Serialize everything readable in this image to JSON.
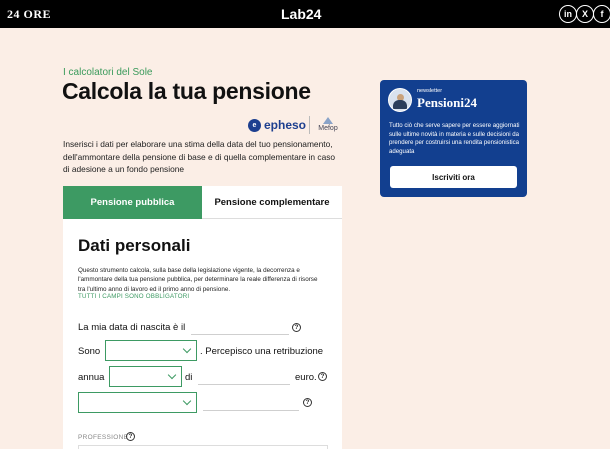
{
  "topbar": {
    "brand_left": "24 ORE",
    "brand_center": "Lab24",
    "social": [
      {
        "icon": "linkedin-icon",
        "glyph": "in"
      },
      {
        "icon": "x-icon",
        "glyph": "X"
      },
      {
        "icon": "facebook-icon",
        "glyph": "f"
      }
    ]
  },
  "hero": {
    "eyebrow": "I calcolatori del Sole",
    "title": "Calcola la tua pensione",
    "sponsor_epheso": "epheso",
    "sponsor_epheso_mark": "e",
    "sponsor_mefop": "Mefop",
    "intro": "Inserisci i dati per elaborare una stima della data del tuo pensionamento, dell'ammontare della pensione di base e di quella complementare in caso di adesione a un fondo pensione"
  },
  "newsletter": {
    "kicker": "newsletter",
    "name": "Pensioni24",
    "description": "Tutto ciò che serve sapere per essere aggiornati sulle ultime novità in materia e sulle decisioni da prendere per costruirsi una rendita pensionistica adeguata",
    "button": "Iscriviti ora"
  },
  "tabs": [
    {
      "label": "Pensione pubblica",
      "active": true
    },
    {
      "label": "Pensione complementare",
      "active": false
    }
  ],
  "form": {
    "section_title": "Dati personali",
    "description": "Questo strumento calcola, sulla base della legislazione vigente, la decorrenza e l'ammontare della tua pensione pubblica, per determinare la reale differenza di risorse tra l'ultimo anno di lavoro ed il primo anno di pensione.",
    "required_note": "TUTTI I CAMPI SONO OBBLIGATORI",
    "birth_label": "La mia data di nascita è il",
    "sono_label": "Sono",
    "percepisco_label": ". Percepisco una retribuzione",
    "annua_label": "annua",
    "di_label": "di",
    "euro_label": "euro.",
    "profession_label": "PROFESSIONE",
    "help_glyph": "?"
  },
  "colors": {
    "accent_green": "#3d9a63",
    "newsletter_blue": "#123f8f",
    "background": "#fbeee6"
  }
}
